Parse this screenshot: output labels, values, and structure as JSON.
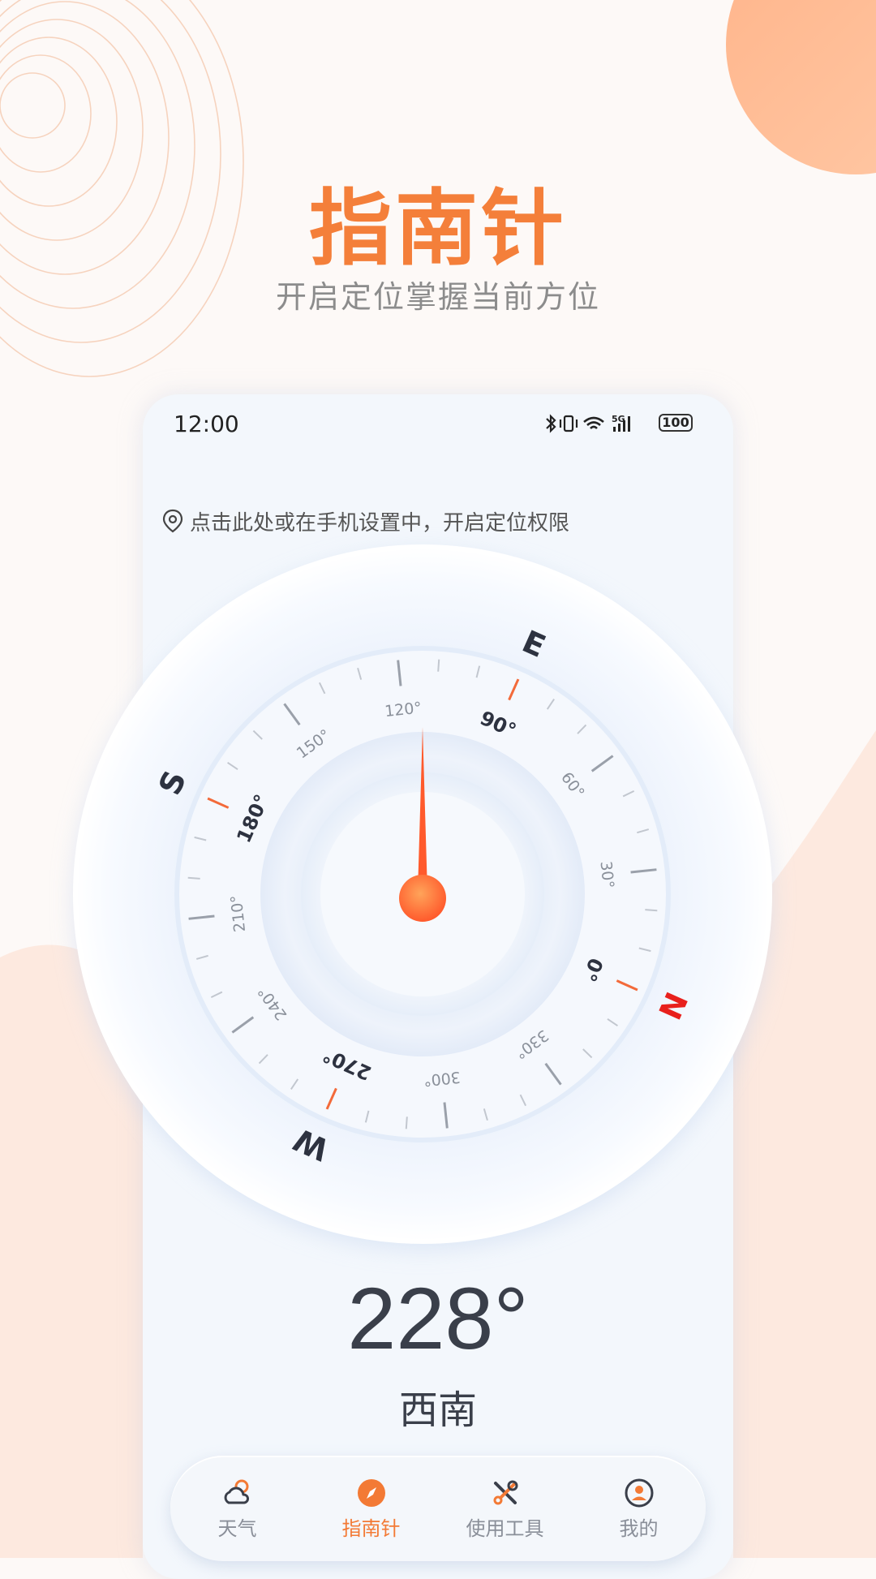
{
  "promo": {
    "title": "指南针",
    "subtitle": "开启定位掌握当前方位"
  },
  "status_bar": {
    "time": "12:00",
    "battery": "100",
    "network": "5G"
  },
  "location_prompt": "点击此处或在手机设置中，开启定位权限",
  "compass": {
    "cardinals": {
      "north": "N",
      "south": "S",
      "east": "E",
      "west": "W"
    },
    "degree_labels": [
      "0°",
      "30°",
      "60°",
      "90°",
      "120°",
      "150°",
      "180°",
      "210°",
      "240°",
      "270°",
      "300°",
      "330°"
    ],
    "needle_heading": 228
  },
  "heading": {
    "degrees": "228°",
    "direction": "西南"
  },
  "tabs": [
    {
      "label": "天气",
      "icon": "weather-icon",
      "active": false
    },
    {
      "label": "指南针",
      "icon": "compass-icon",
      "active": true
    },
    {
      "label": "使用工具",
      "icon": "tools-icon",
      "active": false
    },
    {
      "label": "我的",
      "icon": "profile-icon",
      "active": false
    }
  ],
  "colors": {
    "accent": "#f47f3a",
    "needle": "#ff5a2c",
    "north": "#e8201c",
    "text_dark": "#3a3f4a"
  }
}
